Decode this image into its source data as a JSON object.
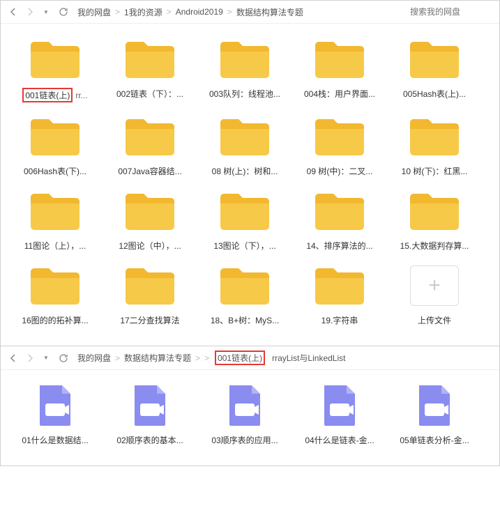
{
  "panel1": {
    "breadcrumbs": [
      "我的网盘",
      "1我的资源",
      "Android2019",
      "数据结构算法专题"
    ],
    "search_placeholder": "搜索我的网盘",
    "folders": [
      {
        "highlight": "001链表(上)",
        "trail": "rr..."
      },
      {
        "label": "002链表（下）：..."
      },
      {
        "label": "003队列：线程池..."
      },
      {
        "label": "004栈：用户界面..."
      },
      {
        "label": "005Hash表(上)..."
      },
      {
        "label": "006Hash表(下)..."
      },
      {
        "label": "007Java容器结..."
      },
      {
        "label": "08 树(上)：树和..."
      },
      {
        "label": "09 树(中)：二叉..."
      },
      {
        "label": "10 树(下)：红黑..."
      },
      {
        "label": "11图论（上），..."
      },
      {
        "label": "12图论（中），..."
      },
      {
        "label": "13图论（下），..."
      },
      {
        "label": "14、排序算法的..."
      },
      {
        "label": "15.大数据判存算..."
      },
      {
        "label": "16图的的拓补算..."
      },
      {
        "label": "17二分查找算法"
      },
      {
        "label": "18、B+树：MyS..."
      },
      {
        "label": "19.字符串"
      }
    ],
    "upload_label": "上传文件"
  },
  "panel2": {
    "breadcrumbs_pre": [
      "我的网盘",
      "数据结构算法专题"
    ],
    "breadcrumb_highlight": "001链表(上)",
    "breadcrumb_trail": "rrayList与LinkedList",
    "videos": [
      {
        "label": "01什么是数据结..."
      },
      {
        "label": "02顺序表的基本..."
      },
      {
        "label": "03顺序表的应用..."
      },
      {
        "label": "04什么是链表-金..."
      },
      {
        "label": "05单链表分析-金..."
      }
    ]
  },
  "sep": ">"
}
